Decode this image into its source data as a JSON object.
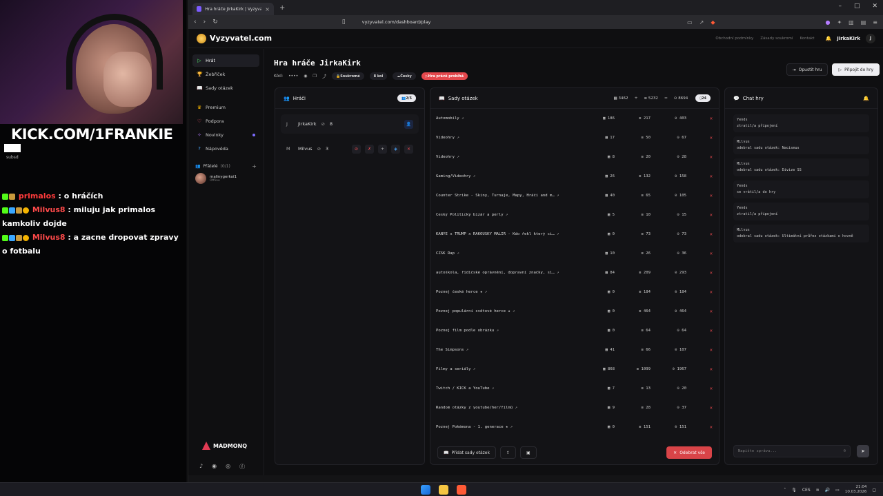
{
  "stream": {
    "kick_prefix": "KICK.COM/",
    "kick_handle": "1FRANKIE",
    "small_tag": "subsd",
    "chat": [
      {
        "user": "primalos",
        "text": ": o hráčích"
      },
      {
        "user": "Milvus8",
        "text": ": miluju jak primalos kamkoliv dojde"
      },
      {
        "user": "Milvus8",
        "text": ": a zacne dropovat zpravy o fotbalu"
      }
    ]
  },
  "browser": {
    "tab_title": "Hra hráče JirkaKirk | Vyzyvatel",
    "url": "vyzyvatel.com/dashboard/play"
  },
  "site": {
    "brand": "Vyzyvatel.com",
    "top_links": [
      "Obchodní podmínky",
      "Zásady soukromí",
      "Kontakt"
    ],
    "user": "JirkaKirk",
    "user_initial": "J",
    "nav": [
      {
        "label": "Hrát",
        "icon": "▷",
        "active": true
      },
      {
        "label": "Žebříček",
        "icon": "🏆"
      },
      {
        "label": "Sady otázek",
        "icon": "📖"
      },
      {
        "label": "Premium",
        "icon": "♛"
      },
      {
        "label": "Podpora",
        "icon": "♡"
      },
      {
        "label": "Novinky",
        "icon": "✧",
        "dot": true
      },
      {
        "label": "Nápověda",
        "icon": "?"
      }
    ],
    "friends_label": "Přátelé",
    "friends_count": "(0/1)",
    "friend": {
      "name": "malinygerkoi1",
      "status": "Offline"
    },
    "sponsor": "MADMONQ",
    "title": "Hra hráče JirkaKirk",
    "code_label": "Kód:",
    "code_value": "••••",
    "pills": {
      "private": "Soukromé",
      "rounds": "8 kol",
      "lang": "Česky",
      "live": "Hra právě probíhá"
    },
    "btn_leave": "Opustit hru",
    "btn_join": "Připojit do hry",
    "players": {
      "title": "Hráči",
      "count": "2/5",
      "rows": [
        {
          "initial": "J",
          "name": "JirkaKirk",
          "score": "8"
        },
        {
          "initial": "M",
          "name": "Milvus",
          "score": "3"
        }
      ]
    },
    "sets": {
      "title": "Sady otázek",
      "sum1": "3462",
      "sum2": "5232",
      "sum3": "8694",
      "count": "24",
      "rows": [
        {
          "name": "Automobily",
          "a": "186",
          "b": "217",
          "c": "403"
        },
        {
          "name": "Videohry",
          "a": "17",
          "b": "50",
          "c": "67"
        },
        {
          "name": "Videohry",
          "a": "8",
          "b": "20",
          "c": "28"
        },
        {
          "name": "Gaming/Videohry",
          "a": "26",
          "b": "132",
          "c": "158"
        },
        {
          "name": "Counter Strike - Skiny, Turnaje, Mapy, Hráči and m…",
          "a": "40",
          "b": "65",
          "c": "105"
        },
        {
          "name": "Český Politický bizár a perly",
          "a": "5",
          "b": "10",
          "c": "15"
        },
        {
          "name": "KANYE x TRUMP x RAKOUSKÝ MALÍŘ - Kdo řekl který ci…",
          "a": "0",
          "b": "73",
          "c": "73"
        },
        {
          "name": "CZSK Rap",
          "a": "10",
          "b": "26",
          "c": "36"
        },
        {
          "name": "autoškola, řidičské oprávnění, dopravní značky, si…",
          "a": "84",
          "b": "209",
          "c": "293"
        },
        {
          "name": "Poznej české herce ★",
          "a": "0",
          "b": "184",
          "c": "184"
        },
        {
          "name": "Poznej populární světové herce ★",
          "a": "0",
          "b": "464",
          "c": "464"
        },
        {
          "name": "Poznej film podle obrázku",
          "a": "0",
          "b": "64",
          "c": "64"
        },
        {
          "name": "The Simpsons",
          "a": "41",
          "b": "66",
          "c": "107"
        },
        {
          "name": "Filmy a seriály",
          "a": "868",
          "b": "1099",
          "c": "1967"
        },
        {
          "name": "Twitch / KICK a YouTube",
          "a": "7",
          "b": "13",
          "c": "20"
        },
        {
          "name": "Random otázky z youtube/her/filmů",
          "a": "9",
          "b": "28",
          "c": "37"
        },
        {
          "name": "Poznej Pokémona - 1. generace ★",
          "a": "0",
          "b": "151",
          "c": "151"
        }
      ],
      "add_btn": "Přidat sady otázek",
      "remove_all": "Odebrat vše"
    },
    "chat": {
      "title": "Chat hry",
      "messages": [
        {
          "user": "Yends",
          "text": "ztratil/a připojení"
        },
        {
          "user": "Milvus",
          "text": "odebral sadu otázek: Nacismus"
        },
        {
          "user": "Milvus",
          "text": "odebral sadu otázek: Divize SS"
        },
        {
          "user": "Yends",
          "text": "se vrátil/a do hry"
        },
        {
          "user": "Yends",
          "text": "ztratil/a připojení"
        },
        {
          "user": "Milvus",
          "text": "odebral sadu otázek: Ultimátní průřez otázkami o hovně"
        }
      ],
      "placeholder": "Napište zprávu..."
    }
  },
  "taskbar": {
    "lang": "CES",
    "time": "21:04",
    "date": "10.03.2026"
  }
}
